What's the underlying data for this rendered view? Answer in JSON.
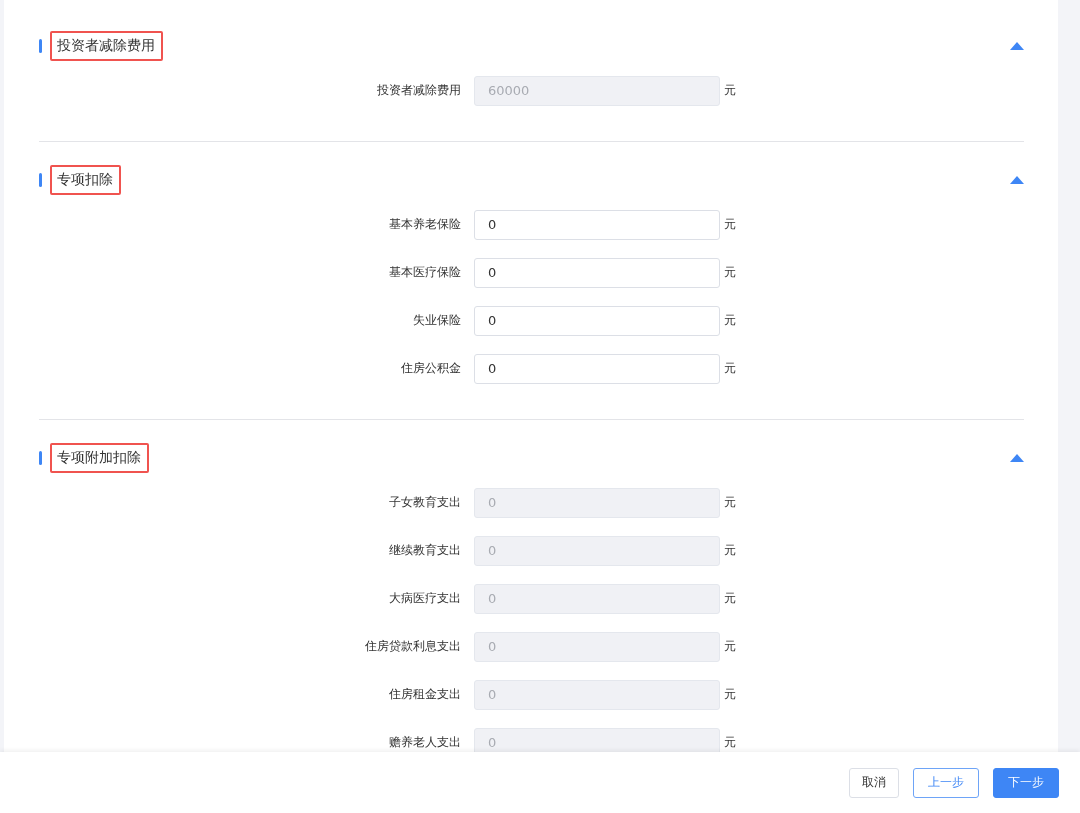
{
  "sections": [
    {
      "title": "投资者减除费用",
      "highlighted": true,
      "expanded": true,
      "fields": [
        {
          "label": "投资者减除费用",
          "value": "60000",
          "unit": "元",
          "disabled": true
        }
      ]
    },
    {
      "title": "专项扣除",
      "highlighted": true,
      "expanded": true,
      "fields": [
        {
          "label": "基本养老保险",
          "value": "0",
          "unit": "元",
          "disabled": false
        },
        {
          "label": "基本医疗保险",
          "value": "0",
          "unit": "元",
          "disabled": false
        },
        {
          "label": "失业保险",
          "value": "0",
          "unit": "元",
          "disabled": false
        },
        {
          "label": "住房公积金",
          "value": "0",
          "unit": "元",
          "disabled": false
        }
      ]
    },
    {
      "title": "专项附加扣除",
      "highlighted": true,
      "expanded": true,
      "fields": [
        {
          "label": "子女教育支出",
          "value": "0",
          "unit": "元",
          "disabled": true
        },
        {
          "label": "继续教育支出",
          "value": "0",
          "unit": "元",
          "disabled": true
        },
        {
          "label": "大病医疗支出",
          "value": "0",
          "unit": "元",
          "disabled": true
        },
        {
          "label": "住房贷款利息支出",
          "value": "0",
          "unit": "元",
          "disabled": true
        },
        {
          "label": "住房租金支出",
          "value": "0",
          "unit": "元",
          "disabled": true
        },
        {
          "label": "赡养老人支出",
          "value": "0",
          "unit": "元",
          "disabled": true
        }
      ]
    }
  ],
  "footer": {
    "buttons": [
      {
        "label": "取消",
        "kind": "default"
      },
      {
        "label": "上一步",
        "kind": "outline"
      },
      {
        "label": "下一步",
        "kind": "primary"
      }
    ]
  }
}
